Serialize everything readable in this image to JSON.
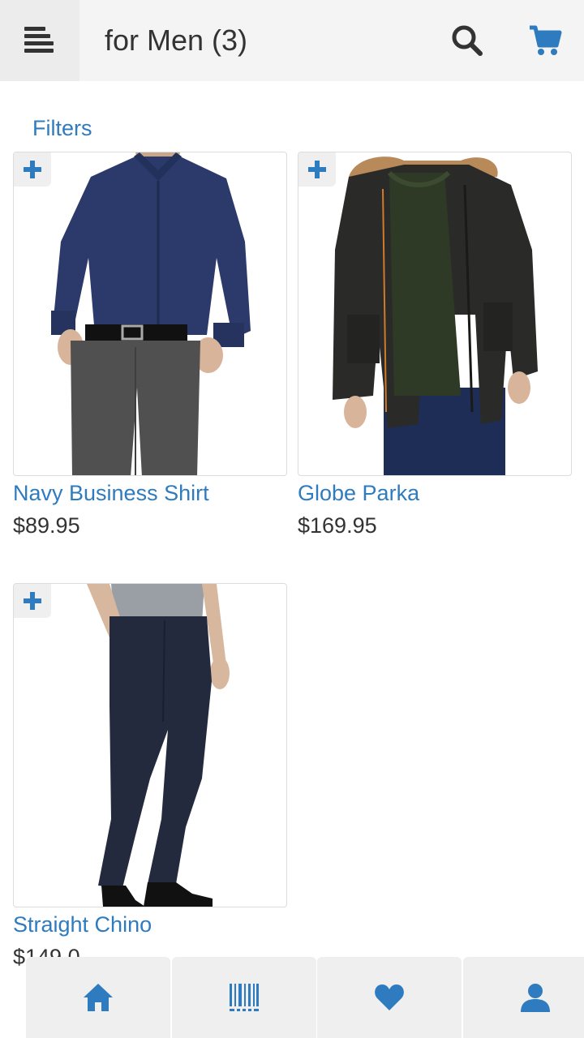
{
  "header": {
    "title": "for Men (3)",
    "menu_icon": "hamburger-menu-icon",
    "search_icon": "search-icon",
    "cart_icon": "shopping-cart-icon"
  },
  "filters_label": "Filters",
  "products": [
    {
      "name": "Navy Business Shirt",
      "price": "$89.95",
      "add_icon": "plus-icon"
    },
    {
      "name": "Globe Parka",
      "price": "$169.95",
      "add_icon": "plus-icon"
    },
    {
      "name": "Straight Chino",
      "price": "$149.0",
      "add_icon": "plus-icon"
    }
  ],
  "bottom_nav": [
    {
      "icon": "home-icon"
    },
    {
      "icon": "barcode-icon"
    },
    {
      "icon": "heart-icon"
    },
    {
      "icon": "user-icon"
    }
  ],
  "colors": {
    "accent": "#2f7bbf",
    "text": "#333333",
    "header_bg": "#f4f4f4",
    "nav_bg": "#efefef"
  }
}
